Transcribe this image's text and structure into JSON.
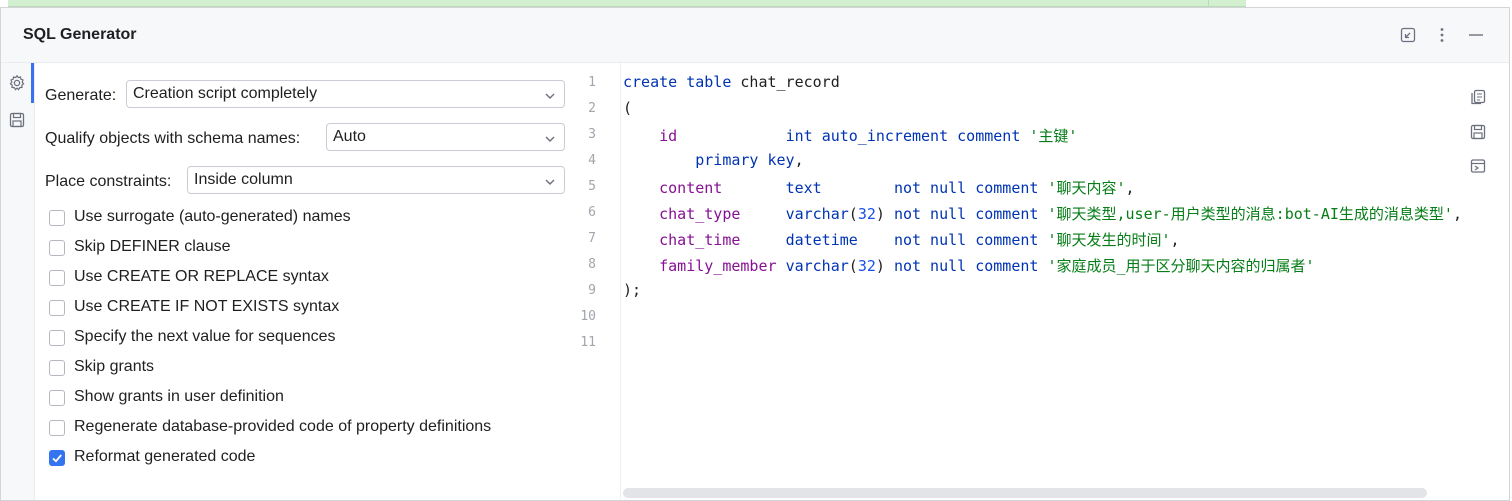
{
  "panel": {
    "title": "SQL Generator",
    "header_icons": [
      "restore-icon",
      "more-vertical-icon",
      "minimize-icon"
    ]
  },
  "sidebar": {
    "icons": [
      "settings-icon",
      "save-icon"
    ]
  },
  "options": {
    "generate": {
      "label": "Generate:",
      "value": "Creation script completely"
    },
    "qualify": {
      "label": "Qualify objects with schema names:",
      "value": "Auto"
    },
    "constraints": {
      "label": "Place constraints:",
      "value": "Inside column"
    },
    "checkboxes": [
      {
        "label": "Use surrogate (auto-generated) names",
        "checked": false
      },
      {
        "label": "Skip DEFINER clause",
        "checked": false
      },
      {
        "label": "Use CREATE OR REPLACE syntax",
        "checked": false
      },
      {
        "label": "Use CREATE IF NOT EXISTS syntax",
        "checked": false
      },
      {
        "label": "Specify the next value for sequences",
        "checked": false
      },
      {
        "label": "Skip grants",
        "checked": false
      },
      {
        "label": "Show grants in user definition",
        "checked": false
      },
      {
        "label": "Regenerate database-provided code of property definitions",
        "checked": false
      },
      {
        "label": "Reformat generated code",
        "checked": true
      }
    ]
  },
  "editor": {
    "line_numbers": [
      "1",
      "2",
      "3",
      "4",
      "5",
      "6",
      "7",
      "8",
      "9",
      "10",
      "11"
    ],
    "lines": [
      "create table chat_record",
      "(",
      "    id            int auto_increment comment '主键'",
      "        primary key,",
      "    content       text        not null comment '聊天内容',",
      "    chat_type     varchar(32) not null comment '聊天类型,user-用户类型的消息:bot-AI生成的消息类型',",
      "    chat_time     datetime    not null comment '聊天发生的时间',",
      "    family_member varchar(32) not null comment '家庭成员_用于区分聊天内容的归属者'",
      ");",
      "",
      ""
    ],
    "tokens": {
      "l1": {
        "kw1": "create",
        "kw2": "table",
        "name": "chat_record"
      },
      "l3": {
        "col": "id",
        "type": "int",
        "kw": "auto_increment",
        "kw2": "comment",
        "str": "'主键'"
      },
      "l4": {
        "kw": "primary",
        "kw2": "key",
        "punct": ","
      },
      "l5": {
        "col": "content",
        "type": "text",
        "kw": "not null",
        "kw2": "comment",
        "str": "'聊天内容'"
      },
      "l6": {
        "col": "chat_type",
        "type": "varchar",
        "num": "32",
        "kw": "not null",
        "kw2": "comment",
        "str": "'聊天类型,user-用户类型的消息:bot-AI生成的消息类型'"
      },
      "l7": {
        "col": "chat_time",
        "type": "datetime",
        "kw": "not null",
        "kw2": "comment",
        "str": "'聊天发生的时间'"
      },
      "l8": {
        "col": "family_member",
        "type": "varchar",
        "num": "32",
        "kw": "not null",
        "kw2": "comment",
        "str": "'家庭成员_用于区分聊天内容的归属者'"
      },
      "l9": {
        "punct": ");"
      }
    },
    "right_icons": [
      "copy-icon",
      "save-icon",
      "run-console-icon"
    ]
  },
  "colors": {
    "accent": "#3574f0",
    "keyword": "#0033b3",
    "column": "#871094",
    "string": "#067d17",
    "number": "#1750eb"
  }
}
